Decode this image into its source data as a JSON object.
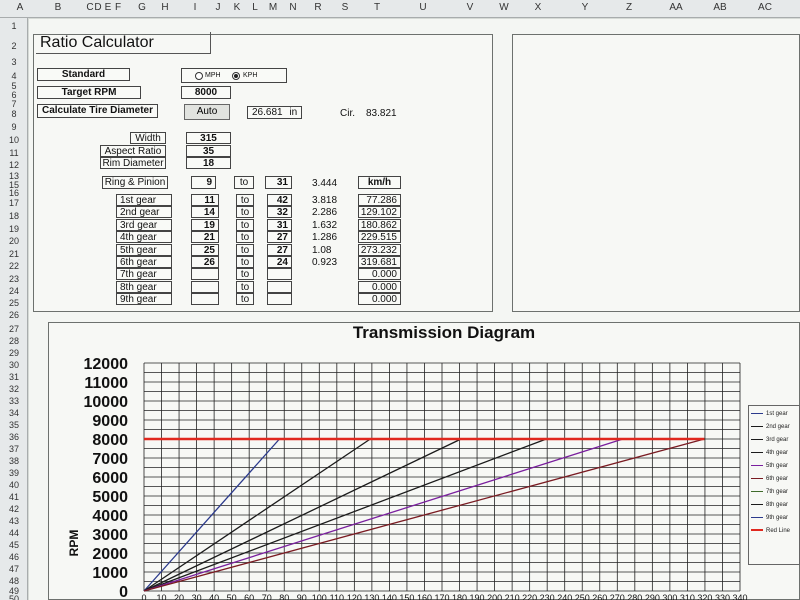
{
  "columns": [
    "A",
    "B",
    "C",
    "D",
    "E",
    "F",
    "G",
    "H",
    "I",
    "J",
    "K",
    "L",
    "M",
    "N",
    "R",
    "S",
    "T",
    "U",
    "V",
    "W",
    "X",
    "Y",
    "Z",
    "AA",
    "AB",
    "AC"
  ],
  "rows": [
    "1",
    "2",
    "3",
    "4",
    "5",
    "6",
    "7",
    "8",
    "9",
    "10",
    "11",
    "12",
    "13",
    "15",
    "16",
    "17",
    "18",
    "19",
    "20",
    "21",
    "22",
    "23",
    "24",
    "25",
    "26",
    "27",
    "28",
    "29",
    "30",
    "31",
    "32",
    "33",
    "34",
    "35",
    "36",
    "37",
    "38",
    "39",
    "40",
    "41",
    "42",
    "43",
    "44",
    "45",
    "46",
    "47",
    "48",
    "49",
    "50"
  ],
  "title": "Ratio Calculator",
  "standard_label": "Standard",
  "mph": "MPH",
  "kph": "KPH",
  "unit_selected": "KPH",
  "target_rpm_label": "Target RPM",
  "target_rpm": "8000",
  "calc_tire_label": "Calculate Tire Diameter",
  "auto_button": "Auto",
  "tire_diameter": "26.681",
  "tire_unit": "in",
  "cir_label": "Cir.",
  "cir_value": "83.821",
  "width_label": "Width",
  "width": "315",
  "aspect_label": "Aspect Ratio",
  "aspect": "35",
  "rim_label": "Rim Diameter",
  "rim": "18",
  "ring_label": "Ring & Pinion",
  "ring_a": "9",
  "ring_to": "to",
  "ring_b": "31",
  "ring_ratio": "3.444",
  "speed_header": "km/h",
  "gears": [
    {
      "label": "1st gear",
      "a": "11",
      "to": "to",
      "b": "42",
      "ratio": "3.818",
      "speed": "77.286"
    },
    {
      "label": "2nd gear",
      "a": "14",
      "to": "to",
      "b": "32",
      "ratio": "2.286",
      "speed": "129.102"
    },
    {
      "label": "3rd gear",
      "a": "19",
      "to": "to",
      "b": "31",
      "ratio": "1.632",
      "speed": "180.862"
    },
    {
      "label": "4th gear",
      "a": "21",
      "to": "to",
      "b": "27",
      "ratio": "1.286",
      "speed": "229.515"
    },
    {
      "label": "5th gear",
      "a": "25",
      "to": "to",
      "b": "27",
      "ratio": "1.08",
      "speed": "273.232"
    },
    {
      "label": "6th gear",
      "a": "26",
      "to": "to",
      "b": "24",
      "ratio": "0.923",
      "speed": "319.681"
    },
    {
      "label": "7th gear",
      "a": "",
      "to": "to",
      "b": "",
      "ratio": "",
      "speed": "0.000"
    },
    {
      "label": "8th gear",
      "a": "",
      "to": "to",
      "b": "",
      "ratio": "",
      "speed": "0.000"
    },
    {
      "label": "9th gear",
      "a": "",
      "to": "to",
      "b": "",
      "ratio": "",
      "speed": "0.000"
    }
  ],
  "chart_data": {
    "type": "line",
    "title": "Transmission Diagram",
    "ylabel": "RPM",
    "xlabel": "",
    "xlim": [
      0,
      340
    ],
    "ylim": [
      0,
      12000
    ],
    "x_ticks": [
      0,
      10,
      20,
      30,
      40,
      50,
      60,
      70,
      80,
      90,
      100,
      110,
      120,
      130,
      140,
      150,
      160,
      170,
      180,
      190,
      200,
      210,
      220,
      230,
      240,
      250,
      260,
      270,
      280,
      290,
      300,
      310,
      320,
      330,
      340
    ],
    "y_ticks": [
      0,
      500,
      1000,
      1500,
      2000,
      2500,
      3000,
      3500,
      4000,
      4500,
      5000,
      5500,
      6000,
      6500,
      7000,
      7500,
      8000,
      8500,
      9000,
      9500,
      10000,
      10500,
      11000,
      11500,
      12000
    ],
    "grid": true,
    "legend_position": "right",
    "series": [
      {
        "name": "1st gear",
        "color": "#2b3a8c",
        "points": [
          [
            0,
            0
          ],
          [
            77.286,
            8000
          ]
        ]
      },
      {
        "name": "2nd gear",
        "color": "#1b1b1b",
        "points": [
          [
            0,
            0
          ],
          [
            129.102,
            8000
          ]
        ]
      },
      {
        "name": "3rd gear",
        "color": "#1b1b1b",
        "points": [
          [
            0,
            0
          ],
          [
            180.862,
            8000
          ]
        ]
      },
      {
        "name": "4th gear",
        "color": "#1b1b1b",
        "points": [
          [
            0,
            0
          ],
          [
            229.515,
            8000
          ]
        ]
      },
      {
        "name": "5th gear",
        "color": "#7a1f9e",
        "points": [
          [
            0,
            0
          ],
          [
            273.232,
            8000
          ]
        ]
      },
      {
        "name": "6th gear",
        "color": "#7a1b22",
        "points": [
          [
            0,
            0
          ],
          [
            319.681,
            8000
          ]
        ]
      },
      {
        "name": "7th gear",
        "color": "#3f6b2a",
        "points": []
      },
      {
        "name": "8th gear",
        "color": "#1b1b1b",
        "points": []
      },
      {
        "name": "9th gear",
        "color": "#2b3a8c",
        "points": []
      },
      {
        "name": "Red Line",
        "color": "#e0281e",
        "points": [
          [
            0,
            8000
          ],
          [
            319.681,
            8000
          ]
        ]
      }
    ]
  }
}
